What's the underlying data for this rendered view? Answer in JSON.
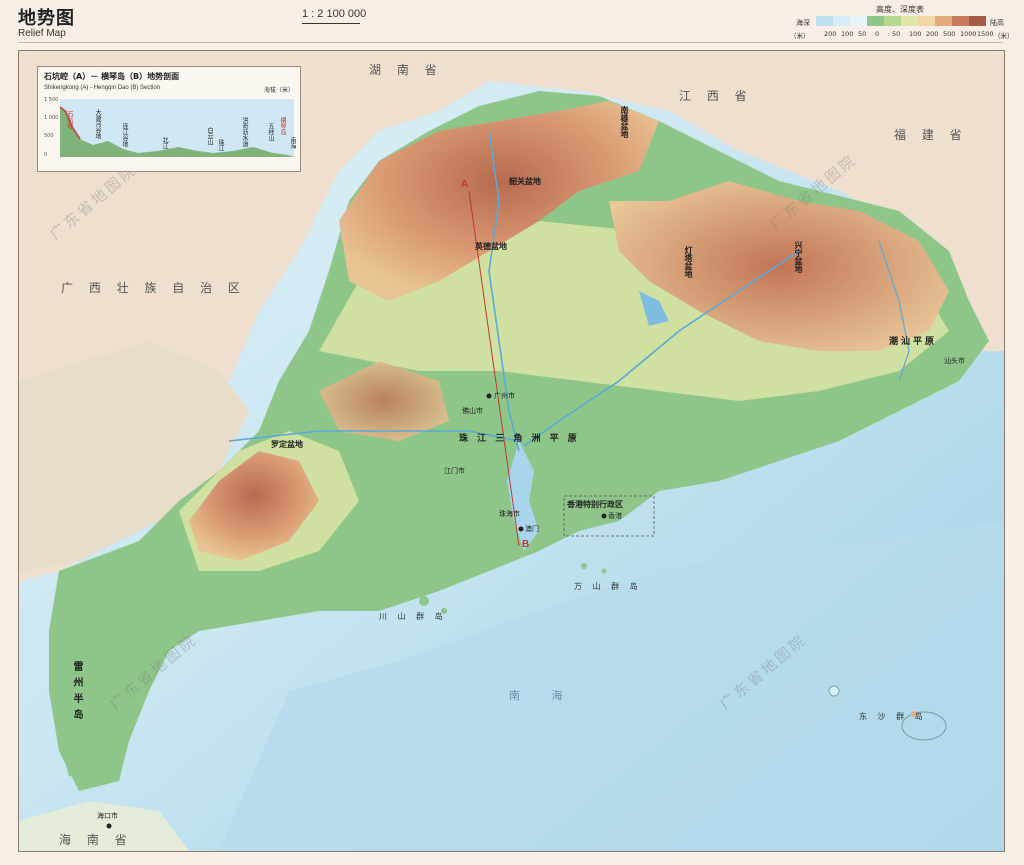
{
  "header": {
    "title": "地势图",
    "subtitle": "Relief Map",
    "scale": "1 : 2 100 000"
  },
  "legend": {
    "title": "高度、深度表",
    "sea_label": "海深",
    "land_label": "陆高",
    "unit": "（米）",
    "ticks": [
      "200",
      "100",
      "50",
      "0",
      "50",
      "100",
      "200",
      "500",
      "1000",
      "1500"
    ],
    "colors": [
      "#bfe0f2",
      "#d6edf6",
      "#e6f4f8",
      "#8ec68a",
      "#b5d88f",
      "#dfe6a6",
      "#f1d7a6",
      "#e3ac7e",
      "#c97a5d",
      "#a45c45"
    ]
  },
  "inset": {
    "title": "石坑崆（A）－ 横琴岛（B）地势剖面",
    "subtitle": "Shikengkong (A) - Hengqin Dao (B) Section",
    "unit": "海拔（米）",
    "y_ticks": [
      "1 500",
      "1 000",
      "500",
      "0"
    ],
    "places": [
      "石坑崆",
      "大源河谷地",
      "连江谷地",
      "北江",
      "白云山",
      "珠江",
      "洪奇沥水道",
      "五桂山",
      "横琴岛",
      "南海"
    ]
  },
  "map": {
    "provinces": [
      "湖 南 省",
      "江 西 省",
      "福 建 省",
      "广 西 壮 族 自 治 区",
      "海 南 省"
    ],
    "basins": [
      "英德盆地",
      "罗定盆地",
      "韶关盆地"
    ],
    "basins_vertical": [
      "南雄盆地",
      "灯塔盆地",
      "兴宁盆地"
    ],
    "plains": [
      "珠 江 三 角 洲 平 原",
      "潮汕平原"
    ],
    "peninsula": "雷州半岛",
    "cities": [
      "广州市",
      "佛山市",
      "澳门",
      "香港",
      "海口市",
      "珠海市",
      "江门市",
      "汕头市"
    ],
    "special_region": "香港特别行政区",
    "sea": "南 海",
    "island_groups": [
      "川 山 群 岛",
      "万 山 群 岛",
      "东 沙 群 岛"
    ],
    "watermark": "广东省地图院",
    "profile_points": [
      "A",
      "B"
    ],
    "colors": {
      "lowland": "#8ec68a",
      "hills": "#dfe6a6",
      "mountains": "#c97a5d",
      "neighbor": "#eedfcf",
      "sea_shallow": "#d4ecf4",
      "sea_deep": "#a9d5ea",
      "river": "#5aa9d6",
      "profile_line": "#c0392b"
    }
  }
}
